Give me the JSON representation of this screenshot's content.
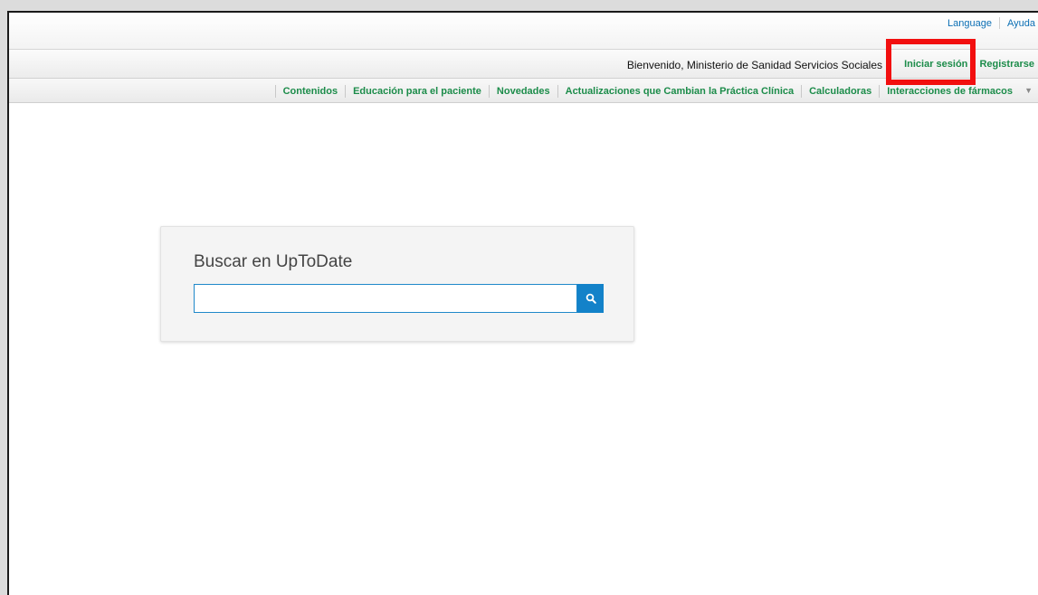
{
  "utility": {
    "language": "Language",
    "help": "Ayuda"
  },
  "welcome": {
    "text": "Bienvenido, Ministerio de Sanidad Servicios Sociales",
    "login": "Iniciar sesión",
    "slash": "/",
    "register": "Registrarse"
  },
  "nav": {
    "items": [
      "Contenidos",
      "Educación para el paciente",
      "Novedades",
      "Actualizaciones que Cambian la Práctica Clínica",
      "Calculadoras",
      "Interacciones de fármacos"
    ],
    "more": "▼"
  },
  "search": {
    "title": "Buscar en UpToDate",
    "value": "",
    "placeholder": ""
  },
  "icons": {
    "search_button": "search-icon",
    "nav_more": "chevron-down-icon"
  },
  "colors": {
    "link_blue": "#0c6fb4",
    "link_green": "#1c8c4a",
    "accent_blue": "#1382c9",
    "highlight_red": "#f20f0f"
  }
}
